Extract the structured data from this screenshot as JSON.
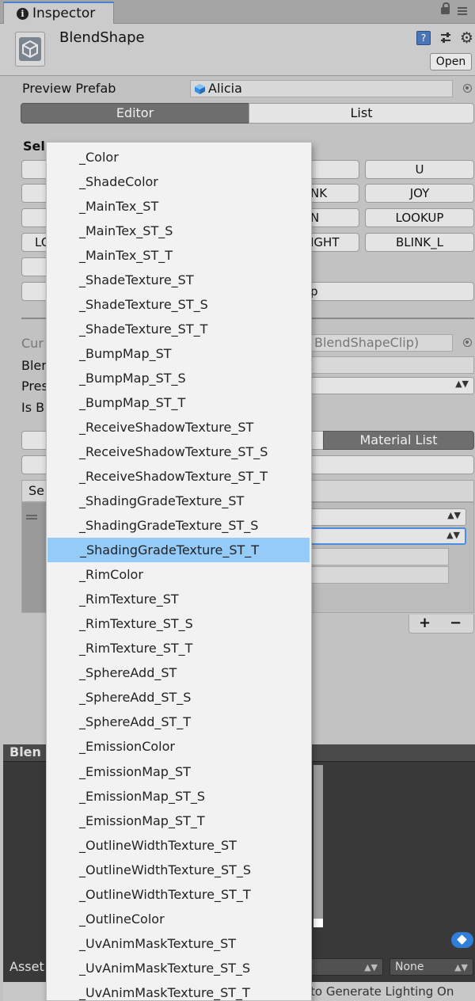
{
  "tab": {
    "title": "Inspector"
  },
  "header": {
    "object_name": "BlendShape",
    "open_label": "Open"
  },
  "preview_prefab": {
    "label": "Preview Prefab",
    "value": "Alicia"
  },
  "editor_tabs": {
    "editor": "Editor",
    "list": "List"
  },
  "select_label": "Sel",
  "clip_buttons": {
    "row1_right": "U",
    "row2_mid": "NK",
    "row2_right": "JOY",
    "row3_mid": "N",
    "row3_right": "LOOKUP",
    "row4_left": "LO",
    "row4_mid": "IGHT",
    "row4_right": "BLINK_L",
    "row6_mid": "p"
  },
  "current_clip": {
    "label": "Cur",
    "value": "BlendShapeClip)"
  },
  "fields": {
    "blend_label": "Blen",
    "preset_label": "Pres",
    "is_label": "Is B"
  },
  "material_tabs": {
    "material_list": "Material List"
  },
  "list_header": "Se",
  "footer_buttons": {
    "add": "+",
    "remove": "−"
  },
  "bottom_panel": {
    "title": "Blen",
    "asset_label": "Asset",
    "none_value": "None",
    "status_text": "to Generate Lighting On"
  },
  "dropdown": {
    "selected_index": 16,
    "items": [
      "_Color",
      "_ShadeColor",
      "_MainTex_ST",
      "_MainTex_ST_S",
      "_MainTex_ST_T",
      "_ShadeTexture_ST",
      "_ShadeTexture_ST_S",
      "_ShadeTexture_ST_T",
      "_BumpMap_ST",
      "_BumpMap_ST_S",
      "_BumpMap_ST_T",
      "_ReceiveShadowTexture_ST",
      "_ReceiveShadowTexture_ST_S",
      "_ReceiveShadowTexture_ST_T",
      "_ShadingGradeTexture_ST",
      "_ShadingGradeTexture_ST_S",
      "_ShadingGradeTexture_ST_T",
      "_RimColor",
      "_RimTexture_ST",
      "_RimTexture_ST_S",
      "_RimTexture_ST_T",
      "_SphereAdd_ST",
      "_SphereAdd_ST_S",
      "_SphereAdd_ST_T",
      "_EmissionColor",
      "_EmissionMap_ST",
      "_EmissionMap_ST_S",
      "_EmissionMap_ST_T",
      "_OutlineWidthTexture_ST",
      "_OutlineWidthTexture_ST_S",
      "_OutlineWidthTexture_ST_T",
      "_OutlineColor",
      "_UvAnimMaskTexture_ST",
      "_UvAnimMaskTexture_ST_S",
      "_UvAnimMaskTexture_ST_T"
    ]
  }
}
